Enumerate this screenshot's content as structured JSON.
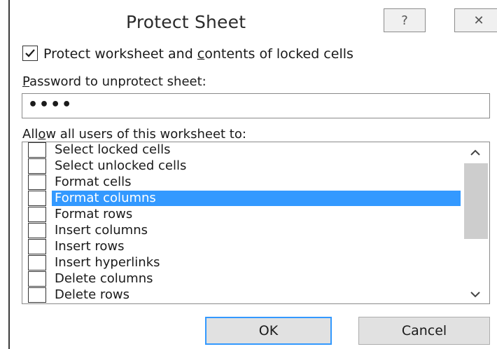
{
  "dialog": {
    "title": "Protect Sheet",
    "help_glyph": "?",
    "close_glyph": "✕"
  },
  "protect_checkbox": {
    "checked": true,
    "label_pre": "Protect worksheet and ",
    "label_accel": "c",
    "label_post": "ontents of locked cells"
  },
  "password": {
    "label_accel": "P",
    "label_rest": "assword to unprotect sheet:",
    "value": "••••"
  },
  "allow": {
    "label_pre": "All",
    "label_accel": "o",
    "label_post": "w all users of this worksheet to:"
  },
  "permissions": [
    {
      "label": "Select locked cells",
      "checked": false,
      "selected": false
    },
    {
      "label": "Select unlocked cells",
      "checked": false,
      "selected": false
    },
    {
      "label": "Format cells",
      "checked": false,
      "selected": false
    },
    {
      "label": "Format columns",
      "checked": false,
      "selected": true
    },
    {
      "label": "Format rows",
      "checked": false,
      "selected": false
    },
    {
      "label": "Insert columns",
      "checked": false,
      "selected": false
    },
    {
      "label": "Insert rows",
      "checked": false,
      "selected": false
    },
    {
      "label": "Insert hyperlinks",
      "checked": false,
      "selected": false
    },
    {
      "label": "Delete columns",
      "checked": false,
      "selected": false
    },
    {
      "label": "Delete rows",
      "checked": false,
      "selected": false
    }
  ],
  "buttons": {
    "ok": "OK",
    "cancel": "Cancel"
  },
  "colors": {
    "selection": "#3399ff",
    "scroll_thumb": "#cdcdcd"
  },
  "icons": {
    "help": "question-mark-icon",
    "close": "close-icon",
    "scroll_up": "chevron-up-icon",
    "scroll_down": "chevron-down-icon",
    "check": "checkmark-icon"
  }
}
